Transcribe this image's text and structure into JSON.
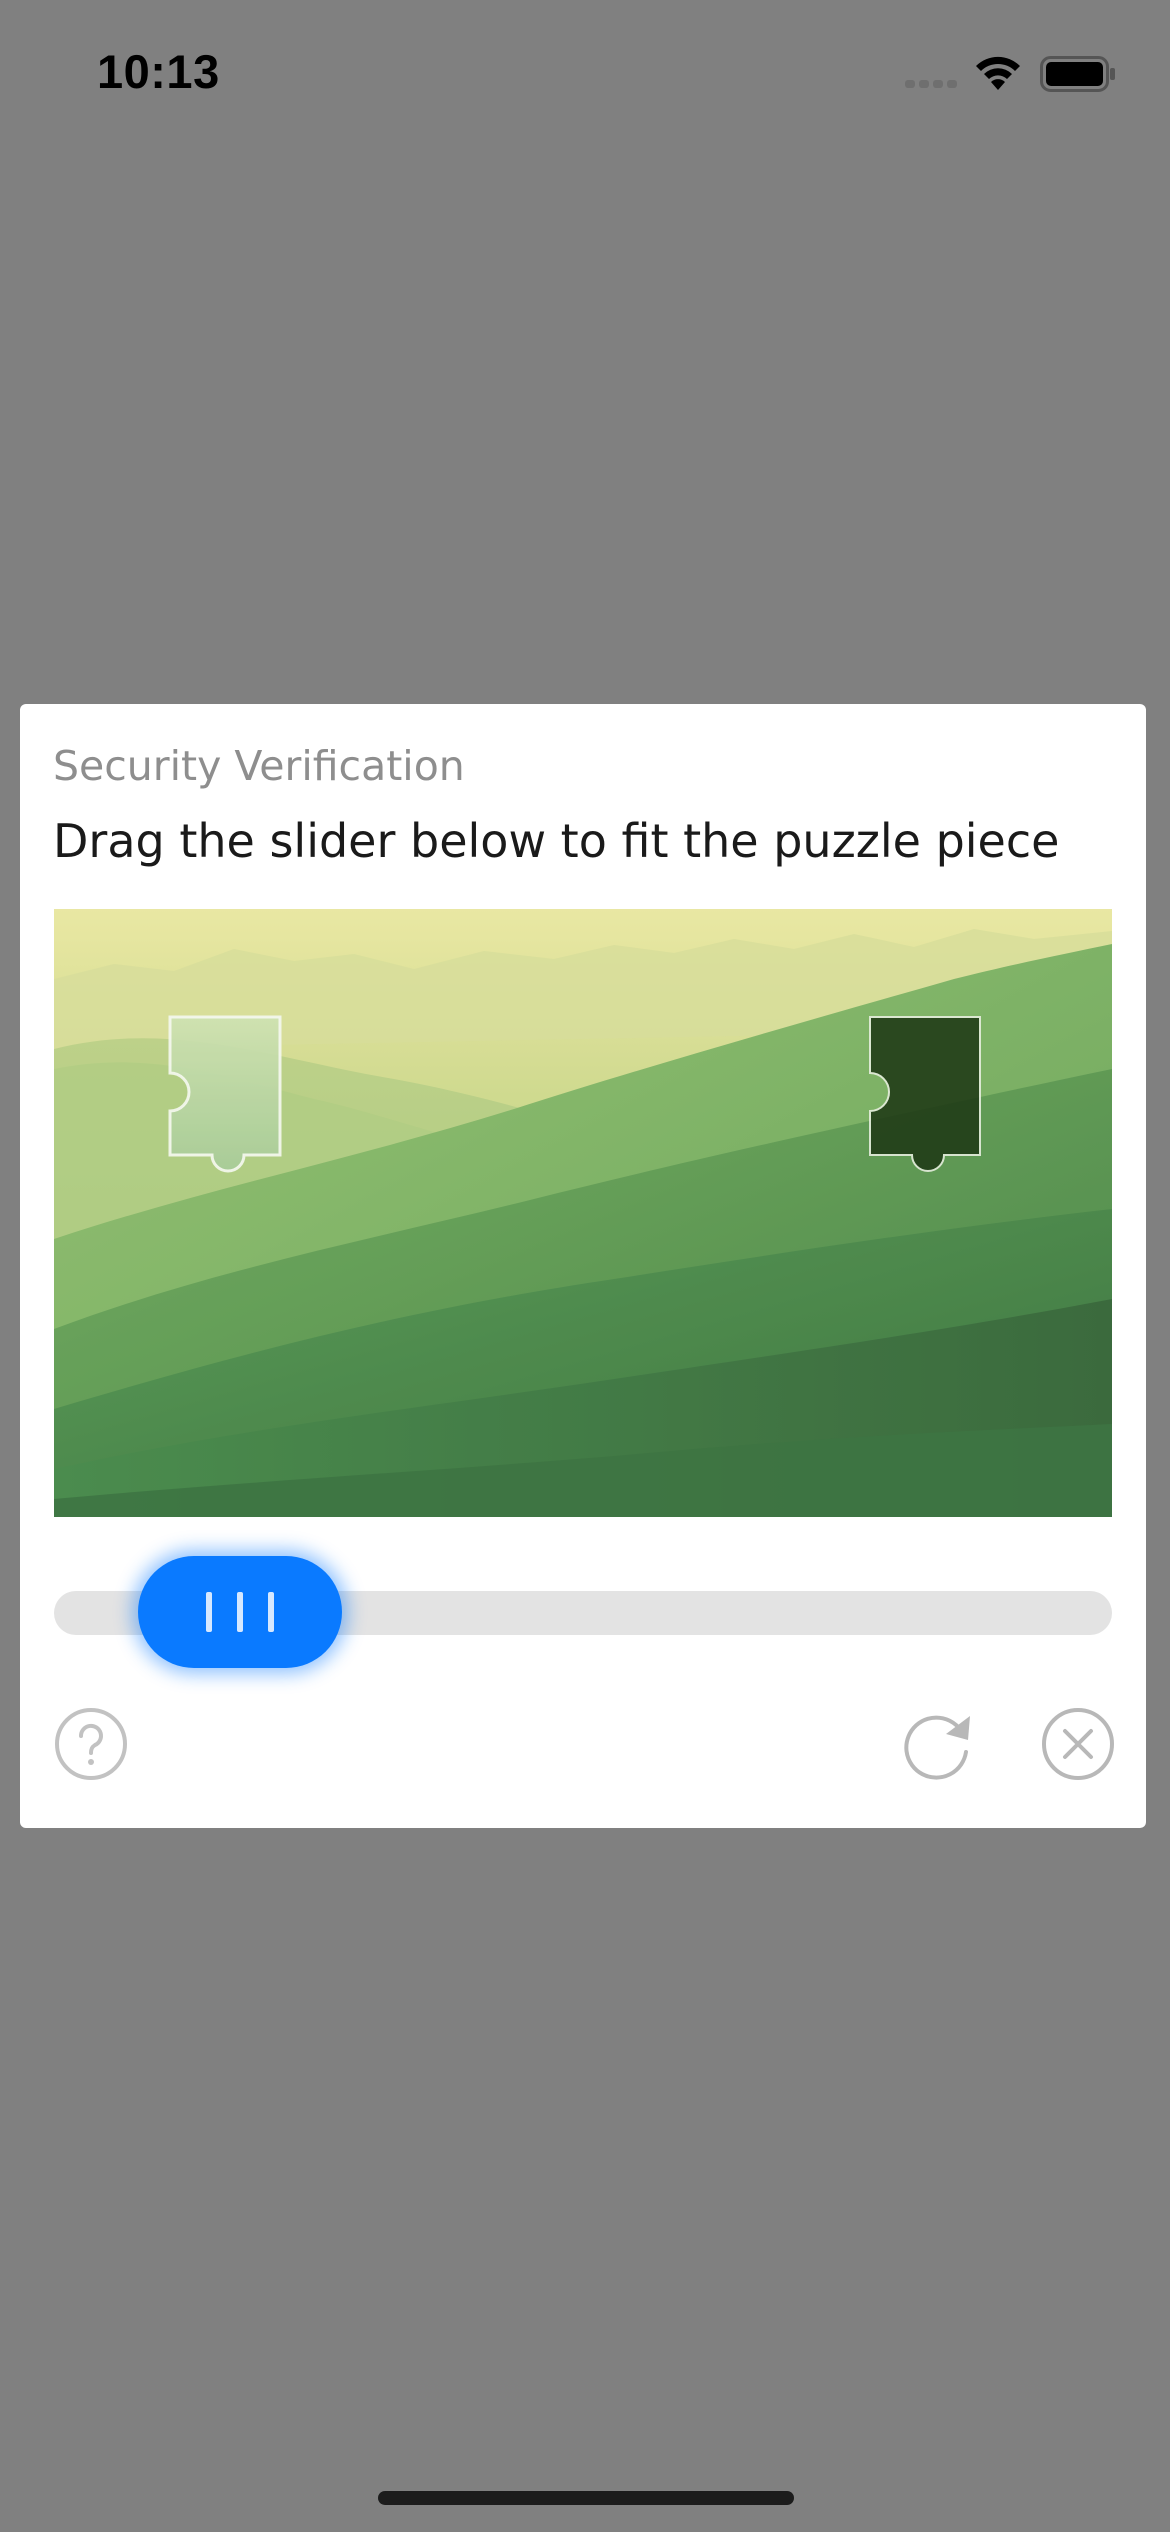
{
  "status_bar": {
    "time": "10:13"
  },
  "dialog": {
    "title": "Security Verification",
    "instruction": "Drag the slider below to fit the puzzle piece"
  },
  "slider": {
    "progress": 0.1
  },
  "icons": {
    "help": "question-circle-icon",
    "refresh": "refresh-icon",
    "close": "close-circle-icon"
  },
  "colors": {
    "overlay": "#808080",
    "accent": "#0a7aff",
    "track": "#e3e3e3",
    "title": "#8e8e8e"
  }
}
